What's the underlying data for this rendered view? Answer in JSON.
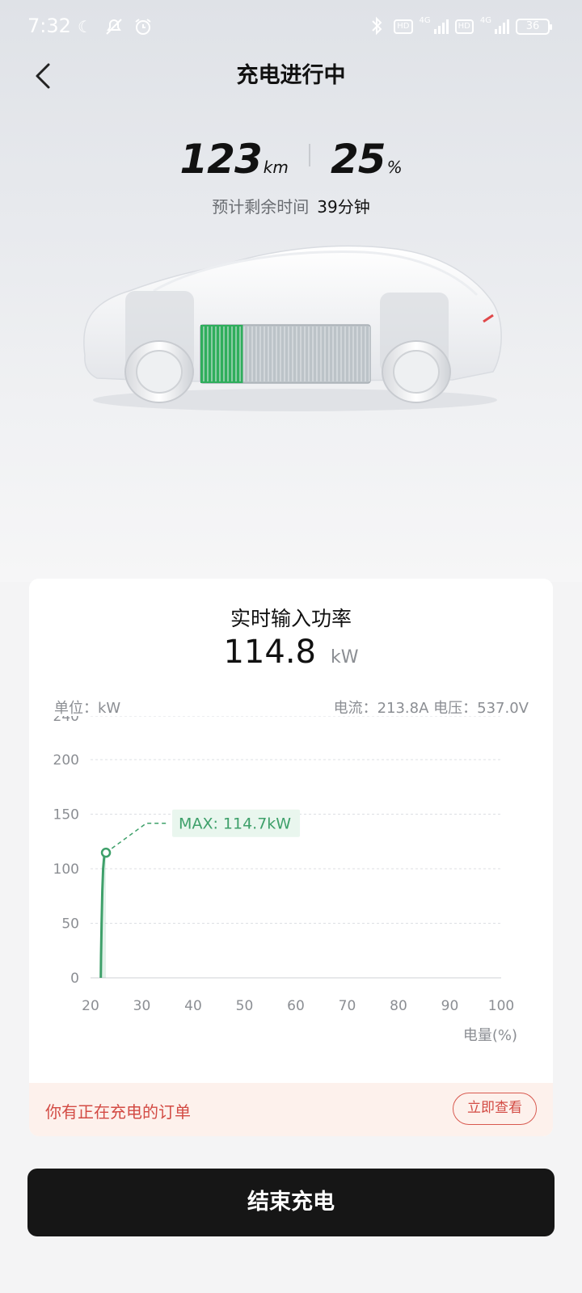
{
  "status_bar": {
    "time": "7:32",
    "hd_badge": "HD",
    "network": "4G",
    "battery": "36"
  },
  "header": {
    "title": "充电进行中"
  },
  "vehicle": {
    "range_value": "123",
    "range_unit": "km",
    "soc_value": "25",
    "soc_unit": "%",
    "remaining_label": "预计剩余时间",
    "remaining_value": "39分钟",
    "battery_fill_fraction": 0.25
  },
  "power_card": {
    "title": "实时输入功率",
    "power_value": "114.8",
    "power_unit": "kW",
    "unit_label": "单位：kW",
    "current_voltage": "电流：213.8A   电压：537.0V"
  },
  "chart_data": {
    "type": "line",
    "title": "实时输入功率",
    "xlabel": "电量(%)",
    "ylabel": "单位：kW",
    "xlim": [
      20,
      100
    ],
    "ylim": [
      0,
      240
    ],
    "x_ticks": [
      20,
      30,
      40,
      50,
      60,
      70,
      80,
      90,
      100
    ],
    "y_ticks": [
      0,
      50,
      100,
      150,
      200,
      240
    ],
    "grid": true,
    "series": [
      {
        "color": "#3ea06a",
        "x": [
          22.0,
          22.05,
          22.15,
          22.3,
          22.45,
          22.6,
          22.7,
          22.85,
          23.0
        ],
        "y": [
          0,
          20,
          50,
          80,
          100,
          108,
          112,
          114,
          114.7
        ]
      }
    ],
    "annotation": {
      "text": "MAX: 114.7kW",
      "x": 23.0,
      "y": 114.7
    }
  },
  "order_banner": {
    "text": "你有正在充电的订单",
    "button": "立即查看"
  },
  "end_button": {
    "label": "结束充电"
  },
  "colors": {
    "accent_green": "#3ea06a",
    "alert_red": "#d34b44",
    "button_black": "#161616"
  }
}
